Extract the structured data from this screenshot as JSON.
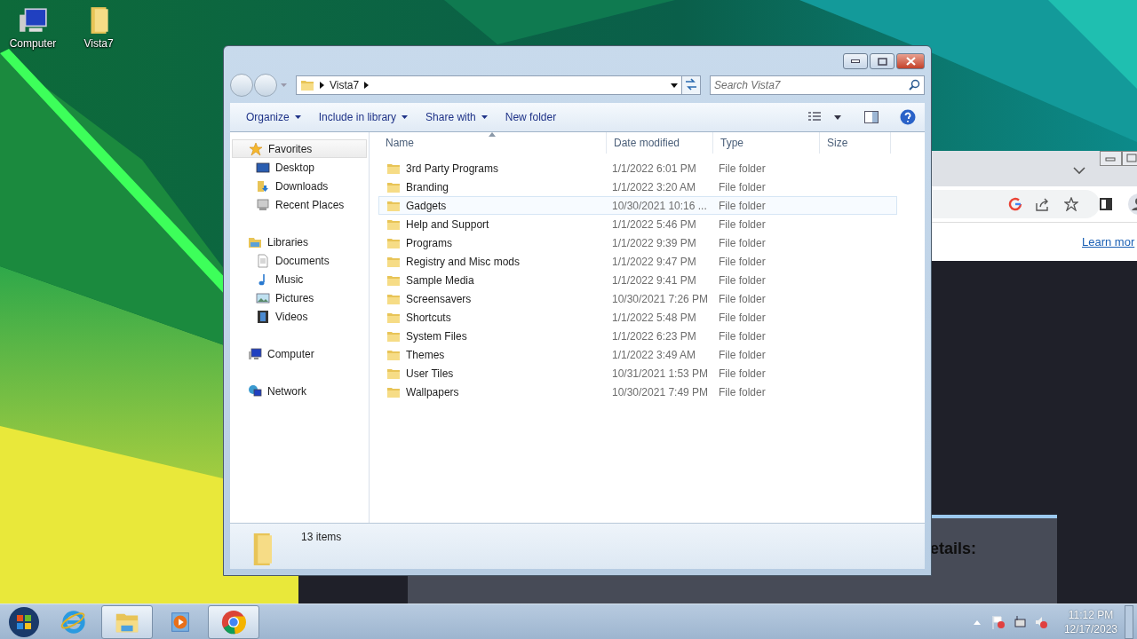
{
  "desktop_icons": [
    {
      "label": "Computer",
      "kind": "computer"
    },
    {
      "label": "Vista7",
      "kind": "folder"
    }
  ],
  "browser_window": {
    "link": "Learn mor"
  },
  "dialog": {
    "heading": "etails:"
  },
  "explorer": {
    "address": {
      "path": [
        "Vista7"
      ]
    },
    "search": {
      "placeholder": "Search Vista7"
    },
    "toolbar": [
      {
        "label": "Organize",
        "dropdown": true
      },
      {
        "label": "Include in library",
        "dropdown": true
      },
      {
        "label": "Share with",
        "dropdown": true
      },
      {
        "label": "New folder",
        "dropdown": false
      }
    ],
    "sidebar": [
      {
        "label": "Favorites",
        "kind": "star",
        "selected": true,
        "children": [
          {
            "label": "Desktop",
            "kind": "desktop",
            "selected": false
          },
          {
            "label": "Downloads",
            "kind": "downloads",
            "selected": false
          },
          {
            "label": "Recent Places",
            "kind": "recent",
            "selected": false
          }
        ]
      },
      {
        "label": "Libraries",
        "kind": "libraries",
        "selected": false,
        "children": [
          {
            "label": "Documents",
            "kind": "documents",
            "selected": false
          },
          {
            "label": "Music",
            "kind": "music",
            "selected": false
          },
          {
            "label": "Pictures",
            "kind": "pictures",
            "selected": false
          },
          {
            "label": "Videos",
            "kind": "videos",
            "selected": false
          }
        ]
      },
      {
        "label": "Computer",
        "kind": "computer",
        "selected": false
      },
      {
        "label": "Network",
        "kind": "network",
        "selected": false
      }
    ],
    "columns": [
      {
        "label": "Name",
        "sorted": true
      },
      {
        "label": "Date modified",
        "sorted": false
      },
      {
        "label": "Type",
        "sorted": false
      },
      {
        "label": "Size",
        "sorted": false
      }
    ],
    "rows": [
      {
        "name": "3rd Party Programs",
        "date": "1/1/2022 6:01 PM",
        "type": "File folder",
        "selected": false
      },
      {
        "name": "Branding",
        "date": "1/1/2022 3:20 AM",
        "type": "File folder",
        "selected": false
      },
      {
        "name": "Gadgets",
        "date": "10/30/2021 10:16 ...",
        "type": "File folder",
        "selected": true
      },
      {
        "name": "Help and Support",
        "date": "1/1/2022 5:46 PM",
        "type": "File folder",
        "selected": false
      },
      {
        "name": "Programs",
        "date": "1/1/2022 9:39 PM",
        "type": "File folder",
        "selected": false
      },
      {
        "name": "Registry and Misc mods",
        "date": "1/1/2022 9:47 PM",
        "type": "File folder",
        "selected": false
      },
      {
        "name": "Sample Media",
        "date": "1/1/2022 9:41 PM",
        "type": "File folder",
        "selected": false
      },
      {
        "name": "Screensavers",
        "date": "10/30/2021 7:26 PM",
        "type": "File folder",
        "selected": false
      },
      {
        "name": "Shortcuts",
        "date": "1/1/2022 5:48 PM",
        "type": "File folder",
        "selected": false
      },
      {
        "name": "System Files",
        "date": "1/1/2022 6:23 PM",
        "type": "File folder",
        "selected": false
      },
      {
        "name": "Themes",
        "date": "1/1/2022 3:49 AM",
        "type": "File folder",
        "selected": false
      },
      {
        "name": "User Tiles",
        "date": "10/31/2021 1:53 PM",
        "type": "File folder",
        "selected": false
      },
      {
        "name": "Wallpapers",
        "date": "10/30/2021 7:49 PM",
        "type": "File folder",
        "selected": false
      }
    ],
    "status_bar": {
      "count": "13 items"
    }
  },
  "taskbar": {
    "apps": [
      {
        "kind": "ie",
        "running": false
      },
      {
        "kind": "explorer",
        "running": true
      },
      {
        "kind": "media",
        "running": false
      },
      {
        "kind": "chrome",
        "running": true
      }
    ],
    "clock": {
      "time": "11:12 PM",
      "date": "12/17/2023"
    }
  }
}
